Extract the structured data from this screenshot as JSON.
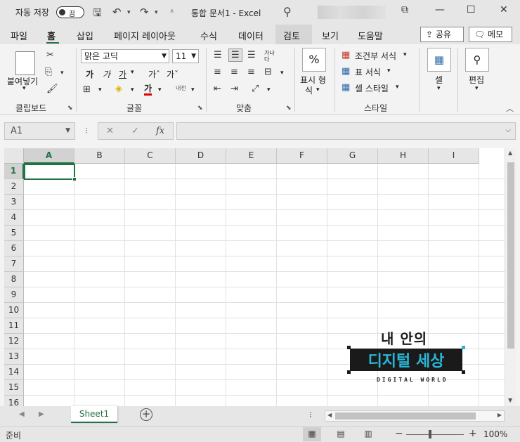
{
  "titlebar": {
    "autosave_label": "자동 저장",
    "autosave_toggle": "끔",
    "title": "통합 문서1  -  Excel",
    "win_restore": "⧉",
    "win_min": "—",
    "win_max": "☐",
    "win_close": "✕"
  },
  "tabs": [
    "파일",
    "홈",
    "삽입",
    "페이지 레이아웃",
    "수식",
    "데이터",
    "검토",
    "보기",
    "도움말"
  ],
  "share_label": "공유",
  "memo_label": "메모",
  "ribbon": {
    "clipboard": {
      "paste_label": "붙여넣기",
      "group_label": "클립보드"
    },
    "font": {
      "font_name": "맑은 고딕",
      "font_size": "11",
      "bold": "가",
      "italic": "가",
      "underline": "가",
      "grow": "가ˆ",
      "shrink": "가ˇ",
      "color_letter": "가",
      "phonetic": "내천",
      "group_label": "글꼴"
    },
    "alignment": {
      "wrap": "가나다",
      "group_label": "맞춤"
    },
    "number": {
      "percent": "%",
      "format_label_1": "표시 형",
      "format_label_2": "식",
      "group_label": ""
    },
    "styles": {
      "conditional": "조건부 서식",
      "table": "표 서식",
      "cell_style": "셀 스타일",
      "group_label": "스타일"
    },
    "cells": {
      "label": "셀"
    },
    "editing": {
      "label": "편집"
    }
  },
  "formula_bar": {
    "name_box": "A1",
    "cancel": "✕",
    "enter": "✓",
    "fx": "fx",
    "value": ""
  },
  "grid": {
    "columns": [
      "A",
      "B",
      "C",
      "D",
      "E",
      "F",
      "G",
      "H",
      "I"
    ],
    "rows": [
      "1",
      "2",
      "3",
      "4",
      "5",
      "6",
      "7",
      "8",
      "9",
      "10",
      "11",
      "12",
      "13",
      "14",
      "15",
      "16"
    ],
    "active_cell": "A1"
  },
  "sheets": [
    "Sheet1"
  ],
  "status": {
    "ready": "준비",
    "zoom": "100%",
    "zoom_minus": "−",
    "zoom_plus": "+"
  },
  "watermark": {
    "line1": "내 안의",
    "line2": "디지털 세상",
    "line3": "DIGITAL WORLD"
  },
  "colors": {
    "accent": "#217346",
    "logo_cyan": "#29b6d6"
  }
}
